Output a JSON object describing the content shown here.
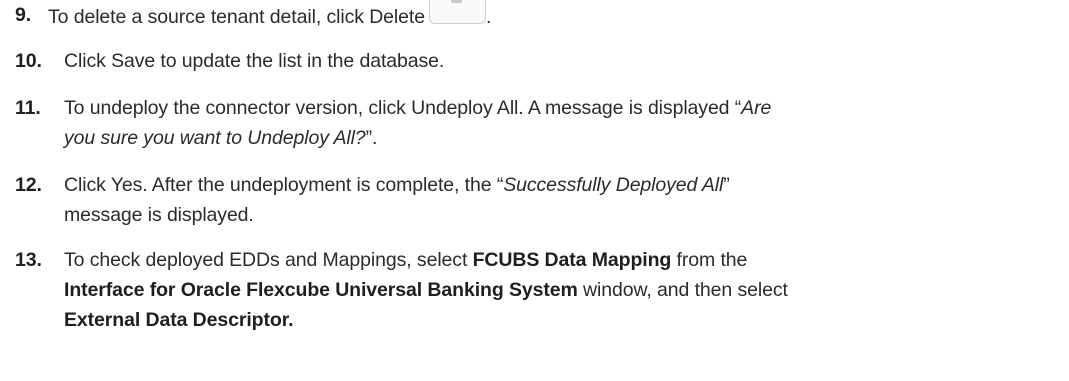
{
  "steps": [
    {
      "num": "9.",
      "parts": [
        "To delete a source tenant detail, click Delete",
        "."
      ],
      "icon": "trash-icon"
    },
    {
      "num": "10.",
      "text": "Click Save to update the list in the database."
    },
    {
      "num": "11.",
      "line1_a": "To undeploy the connector version, click Undeploy All. A message is displayed “",
      "line1_em": "Are",
      "line2_em": "you sure you want to Undeploy All?",
      "line2_b": "”."
    },
    {
      "num": "12.",
      "a": "Click Yes. After the undeployment is complete, the “",
      "em": "Successfully Deployed All",
      "b": "”",
      "line2": "message is displayed."
    },
    {
      "num": "13.",
      "a": "To check deployed EDDs and Mappings, select ",
      "b1": "FCUBS Data Mapping",
      "c": " from the",
      "b2": "Interface for Oracle Flexcube Universal Banking System",
      "d": " window, and then select",
      "b3": "External Data Descriptor."
    }
  ]
}
